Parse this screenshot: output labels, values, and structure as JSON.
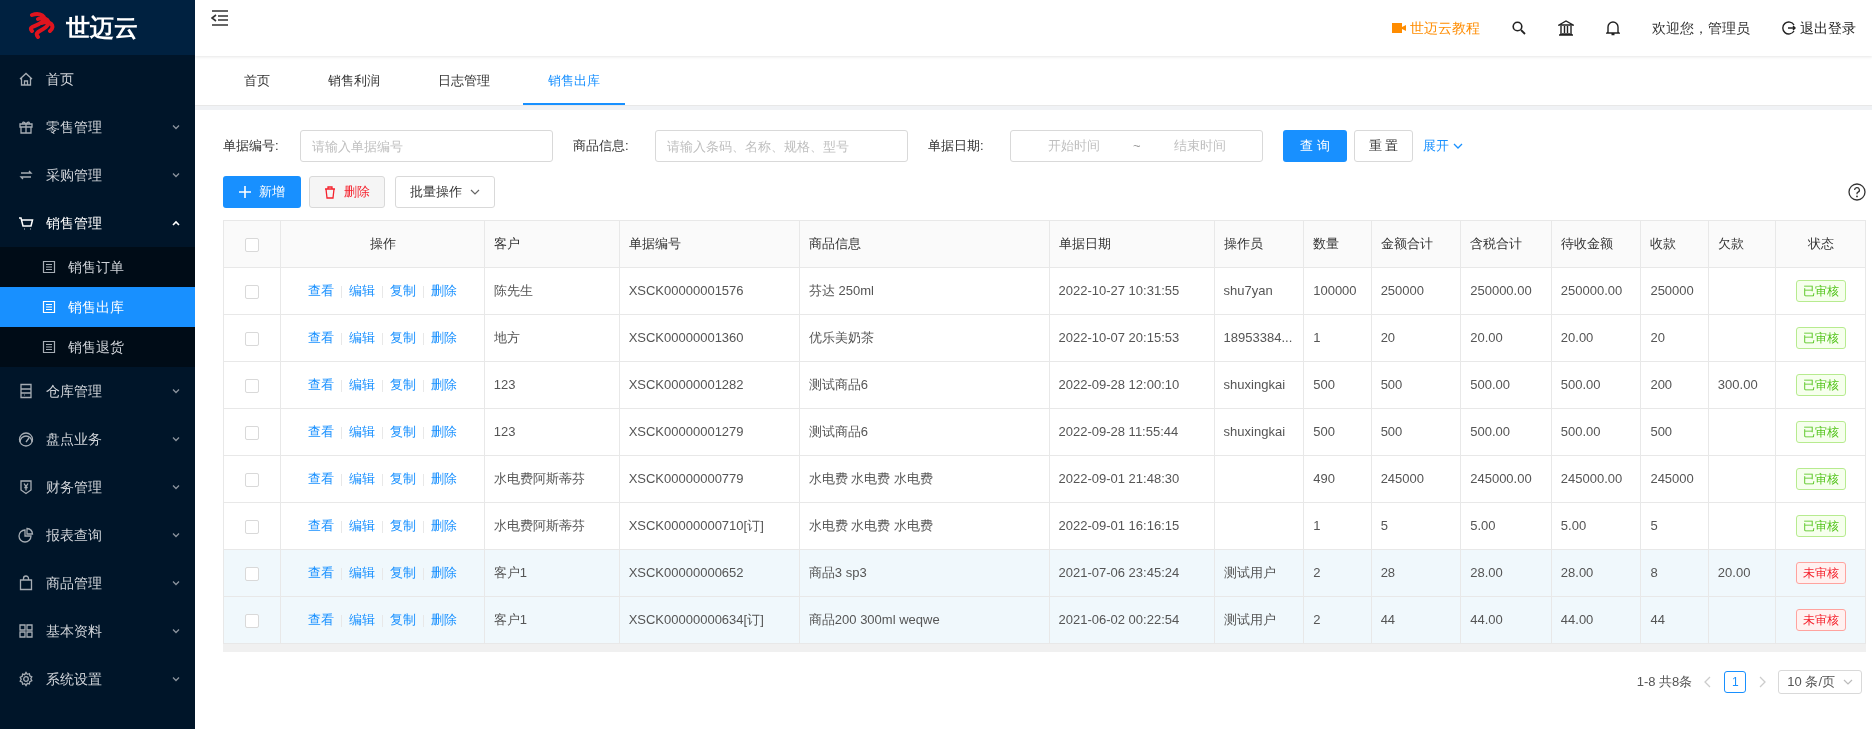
{
  "sidebar": {
    "logo": "世迈云",
    "items": [
      {
        "label": "首页",
        "kind": "link",
        "expanded": false,
        "selected": false
      },
      {
        "label": "零售管理",
        "kind": "menu",
        "expanded": false,
        "selected": false
      },
      {
        "label": "采购管理",
        "kind": "menu",
        "expanded": false,
        "selected": false
      },
      {
        "label": "销售管理",
        "kind": "menu",
        "expanded": true,
        "selected": false,
        "children": [
          {
            "label": "销售订单",
            "selected": false
          },
          {
            "label": "销售出库",
            "selected": true
          },
          {
            "label": "销售退货",
            "selected": false
          }
        ]
      },
      {
        "label": "仓库管理",
        "kind": "menu",
        "expanded": false,
        "selected": false
      },
      {
        "label": "盘点业务",
        "kind": "menu",
        "expanded": false,
        "selected": false
      },
      {
        "label": "财务管理",
        "kind": "menu",
        "expanded": false,
        "selected": false
      },
      {
        "label": "报表查询",
        "kind": "menu",
        "expanded": false,
        "selected": false
      },
      {
        "label": "商品管理",
        "kind": "menu",
        "expanded": false,
        "selected": false
      },
      {
        "label": "基本资料",
        "kind": "menu",
        "expanded": false,
        "selected": false
      },
      {
        "label": "系统设置",
        "kind": "menu",
        "expanded": false,
        "selected": false
      }
    ]
  },
  "header": {
    "tutorial": "世迈云教程",
    "welcome": "欢迎您，管理员",
    "logout": "退出登录"
  },
  "tabs": [
    {
      "label": "首页",
      "selected": false
    },
    {
      "label": "销售利润",
      "selected": false
    },
    {
      "label": "日志管理",
      "selected": false
    },
    {
      "label": "销售出库",
      "selected": true
    }
  ],
  "filters": [
    {
      "kind": "text",
      "label": "单据编号:",
      "placeholder": "请输入单据编号"
    },
    {
      "kind": "text",
      "label": "商品信息:",
      "placeholder": "请输入条码、名称、规格、型号"
    },
    {
      "kind": "range",
      "label": "单据日期:",
      "start_placeholder": "开始时间",
      "separator": "~",
      "end_placeholder": "结束时间"
    }
  ],
  "filter_buttons": {
    "search": "查 询",
    "reset": "重 置",
    "expand": "展开"
  },
  "toolbar": {
    "add": "新增",
    "delete": "删除",
    "batch": "批量操作"
  },
  "table": {
    "all_checked": false,
    "actions_header": "操作",
    "status_header": "状态",
    "columns": [
      "客户",
      "单据编号",
      "商品信息",
      "单据日期",
      "操作员",
      "数量",
      "金额合计",
      "含税合计",
      "待收金额",
      "收款",
      "欠款"
    ],
    "rows": [
      {
        "checked": false,
        "highlighted": false,
        "actions": [
          "查看",
          "编辑",
          "复制",
          "删除"
        ],
        "cells": [
          "陈先生",
          "XSCK00000001576",
          "芬达 250ml",
          "2022-10-27 10:31:55",
          "shu7yan",
          "100000",
          "250000",
          "250000.00",
          "250000.00",
          "250000",
          ""
        ],
        "status": {
          "label": "已审核",
          "kind": "approved"
        }
      },
      {
        "checked": false,
        "highlighted": false,
        "actions": [
          "查看",
          "编辑",
          "复制",
          "删除"
        ],
        "cells": [
          "地方",
          "XSCK00000001360",
          "优乐美奶茶",
          "2022-10-07 20:15:53",
          "18953384...",
          "1",
          "20",
          "20.00",
          "20.00",
          "20",
          ""
        ],
        "status": {
          "label": "已审核",
          "kind": "approved"
        }
      },
      {
        "checked": false,
        "highlighted": false,
        "actions": [
          "查看",
          "编辑",
          "复制",
          "删除"
        ],
        "cells": [
          "123",
          "XSCK00000001282",
          "测试商品6",
          "2022-09-28 12:00:10",
          "shuxingkai",
          "500",
          "500",
          "500.00",
          "500.00",
          "200",
          "300.00"
        ],
        "status": {
          "label": "已审核",
          "kind": "approved"
        }
      },
      {
        "checked": false,
        "highlighted": false,
        "actions": [
          "查看",
          "编辑",
          "复制",
          "删除"
        ],
        "cells": [
          "123",
          "XSCK00000001279",
          "测试商品6",
          "2022-09-28 11:55:44",
          "shuxingkai",
          "500",
          "500",
          "500.00",
          "500.00",
          "500",
          ""
        ],
        "status": {
          "label": "已审核",
          "kind": "approved"
        }
      },
      {
        "checked": false,
        "highlighted": false,
        "actions": [
          "查看",
          "编辑",
          "复制",
          "删除"
        ],
        "cells": [
          "水电费阿斯蒂芬",
          "XSCK00000000779",
          "水电费 水电费 水电费",
          "2022-09-01 21:48:30",
          "",
          "490",
          "245000",
          "245000.00",
          "245000.00",
          "245000",
          ""
        ],
        "status": {
          "label": "已审核",
          "kind": "approved"
        }
      },
      {
        "checked": false,
        "highlighted": false,
        "actions": [
          "查看",
          "编辑",
          "复制",
          "删除"
        ],
        "cells": [
          "水电费阿斯蒂芬",
          "XSCK00000000710[订]",
          "水电费 水电费 水电费",
          "2022-09-01 16:16:15",
          "",
          "1",
          "5",
          "5.00",
          "5.00",
          "5",
          ""
        ],
        "status": {
          "label": "已审核",
          "kind": "approved"
        }
      },
      {
        "checked": false,
        "highlighted": true,
        "actions": [
          "查看",
          "编辑",
          "复制",
          "删除"
        ],
        "cells": [
          "客户1",
          "XSCK00000000652",
          "商品3 sp3",
          "2021-07-06 23:45:24",
          "测试用户",
          "2",
          "28",
          "28.00",
          "28.00",
          "8",
          "20.00"
        ],
        "status": {
          "label": "未审核",
          "kind": "pending"
        }
      },
      {
        "checked": false,
        "highlighted": true,
        "actions": [
          "查看",
          "编辑",
          "复制",
          "删除"
        ],
        "cells": [
          "客户1",
          "XSCK00000000634[订]",
          "商品200 300ml weqwe",
          "2021-06-02 00:22:54",
          "测试用户",
          "2",
          "44",
          "44.00",
          "44.00",
          "44",
          ""
        ],
        "status": {
          "label": "未审核",
          "kind": "pending"
        }
      }
    ]
  },
  "pagination": {
    "summary": "1-8 共8条",
    "pages": [
      {
        "label": "1",
        "selected": true
      }
    ],
    "page_size": "10 条/页"
  }
}
